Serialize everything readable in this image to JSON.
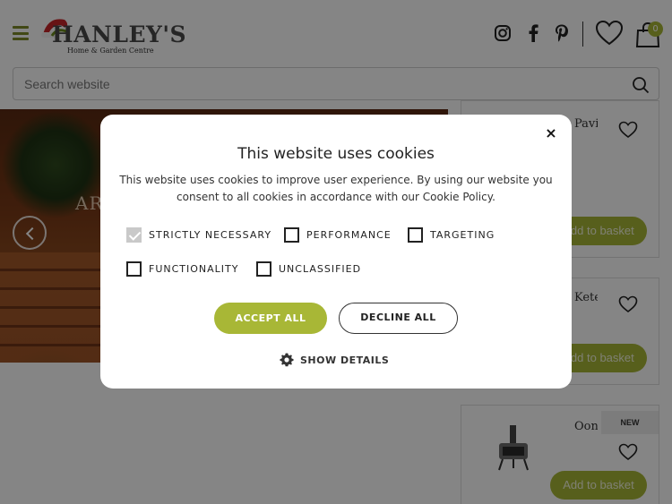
{
  "header": {
    "logo": {
      "word": "HANLEY'S",
      "subtitle": "Home & Garden Centre"
    },
    "cart_count": "0",
    "icons": [
      "menu-icon",
      "instagram-icon",
      "facebook-icon",
      "pinterest-icon",
      "heart-icon",
      "bag-icon"
    ]
  },
  "search": {
    "placeholder": "Search website"
  },
  "hero": {
    "text": "AR"
  },
  "products": [
    {
      "name": "Pavili...",
      "button": "Add to basket",
      "badge": ""
    },
    {
      "name": "Keter...",
      "button": "Add to basket",
      "badge": ""
    },
    {
      "name": "Ooni...",
      "button": "Add to basket",
      "badge": "NEW"
    }
  ],
  "cookie_modal": {
    "title": "This website uses cookies",
    "description": "This website uses cookies to improve user experience. By using our website you consent to all cookies in accordance with our Cookie Policy.",
    "options": [
      {
        "label": "STRICTLY NECESSARY",
        "checked": true
      },
      {
        "label": "PERFORMANCE",
        "checked": false
      },
      {
        "label": "TARGETING",
        "checked": false
      },
      {
        "label": "FUNCTIONALITY",
        "checked": false
      },
      {
        "label": "UNCLASSIFIED",
        "checked": false
      }
    ],
    "accept_label": "ACCEPT ALL",
    "decline_label": "DECLINE ALL",
    "details_label": "SHOW DETAILS",
    "close_label": "×"
  },
  "colors": {
    "brand_green": "#a8b736",
    "overlay": "rgba(0,0,0,0.48)"
  }
}
